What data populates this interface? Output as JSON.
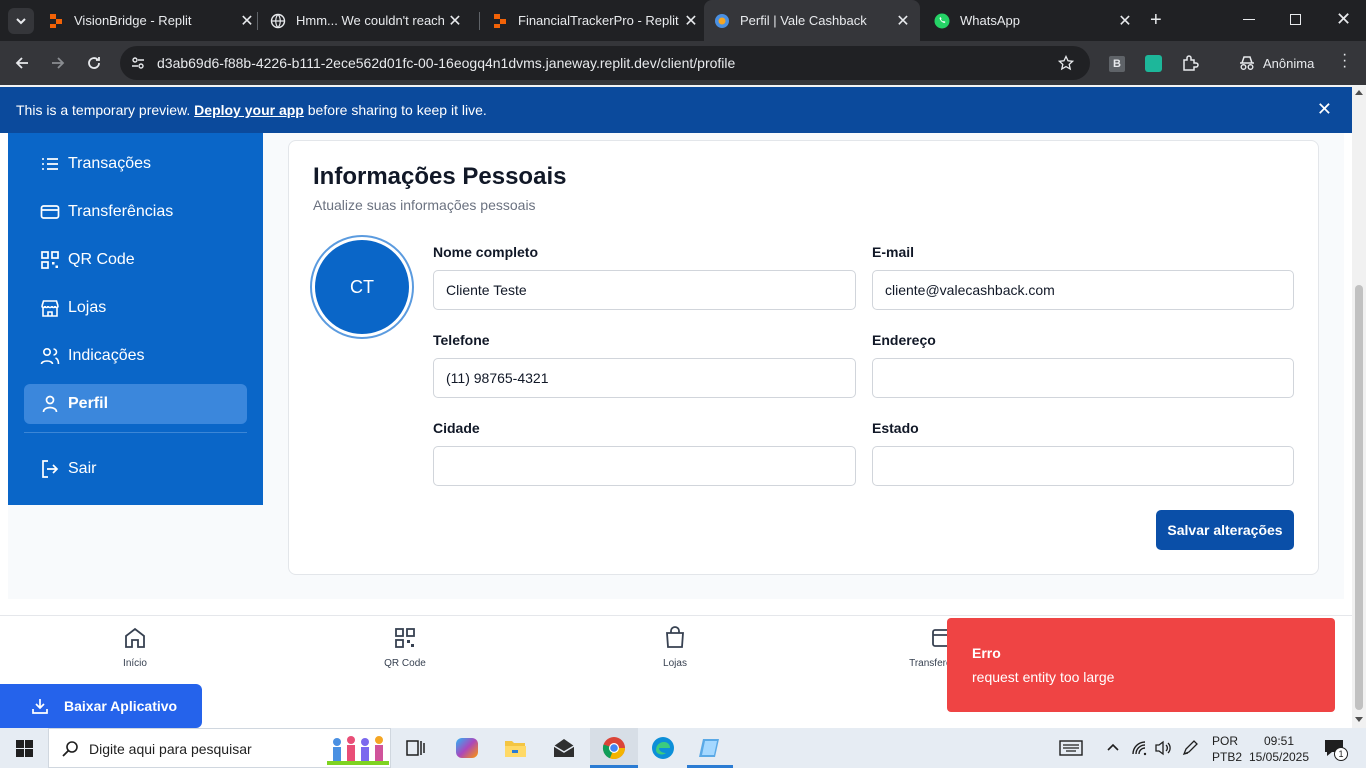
{
  "browser": {
    "tabs": [
      {
        "title": "VisionBridge - Replit",
        "active": false
      },
      {
        "title": "Hmm... We couldn't reach this",
        "active": false
      },
      {
        "title": "FinancialTrackerPro - Replit",
        "active": false
      },
      {
        "title": "Perfil | Vale Cashback",
        "active": true
      },
      {
        "title": "WhatsApp",
        "active": false
      }
    ],
    "url": "d3ab69d6-f88b-4226-b111-2ece562d01fc-00-16eogq4n1dvms.janeway.replit.dev/client/profile",
    "profile_label": "Anônima",
    "extension_b": "B"
  },
  "banner": {
    "text_before": "This is a temporary preview. ",
    "link": "Deploy your app",
    "text_after": " before sharing to keep it live."
  },
  "sidebar": {
    "items": [
      {
        "label": "Transações",
        "icon": "list-icon"
      },
      {
        "label": "Transferências",
        "icon": "credit-card-icon"
      },
      {
        "label": "QR Code",
        "icon": "qr-code-icon"
      },
      {
        "label": "Lojas",
        "icon": "store-icon"
      },
      {
        "label": "Indicações",
        "icon": "users-icon"
      },
      {
        "label": "Perfil",
        "icon": "user-icon",
        "active": true
      }
    ],
    "logout": "Sair"
  },
  "profile": {
    "title": "Informações Pessoais",
    "subtitle": "Atualize suas informações pessoais",
    "avatar_initials": "CT",
    "fields": {
      "name": {
        "label": "Nome completo",
        "value": "Cliente Teste"
      },
      "email": {
        "label": "E-mail",
        "value": "cliente@valecashback.com"
      },
      "phone": {
        "label": "Telefone",
        "value": "(11) 98765-4321"
      },
      "address": {
        "label": "Endereço",
        "value": ""
      },
      "city": {
        "label": "Cidade",
        "value": ""
      },
      "state": {
        "label": "Estado",
        "value": ""
      }
    },
    "save_label": "Salvar alterações"
  },
  "bottom_nav": {
    "items": [
      {
        "label": "Início",
        "icon": "home-icon"
      },
      {
        "label": "QR Code",
        "icon": "qr-code-icon"
      },
      {
        "label": "Lojas",
        "icon": "shopping-bag-icon"
      },
      {
        "label": "Transferências",
        "icon": "transfer-icon"
      }
    ]
  },
  "download_label": "Baixar Aplicativo",
  "toast": {
    "title": "Erro",
    "message": "request entity too large"
  },
  "taskbar": {
    "search_placeholder": "Digite aqui para pesquisar",
    "lang_top": "POR",
    "lang_bottom": "PTB2",
    "time": "09:51",
    "date": "15/05/2025",
    "notification_count": "1"
  },
  "colors": {
    "sidebar": "#0a66c8",
    "primary_button": "#0a4fa8",
    "toast": "#ef4444",
    "banner": "#0b4a9c"
  }
}
